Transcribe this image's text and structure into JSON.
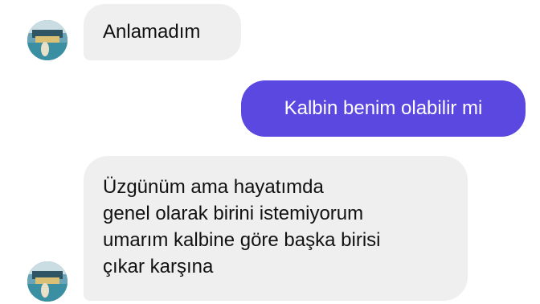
{
  "messages": [
    {
      "sender": "other",
      "text": "Anlamadım"
    },
    {
      "sender": "me",
      "text": "Kalbin benim olabilir mi"
    },
    {
      "sender": "other",
      "text": "Üzgünüm ama hayatımda\ngenel olarak birini istemiyorum\numarım kalbine göre başka birisi\nçıkar karşına"
    }
  ],
  "colors": {
    "incoming_bubble": "#efefef",
    "outgoing_bubble": "#5a48e0",
    "incoming_text": "#111111",
    "outgoing_text": "#ffffff"
  },
  "icons": {
    "avatar": "contact-avatar-photo"
  }
}
